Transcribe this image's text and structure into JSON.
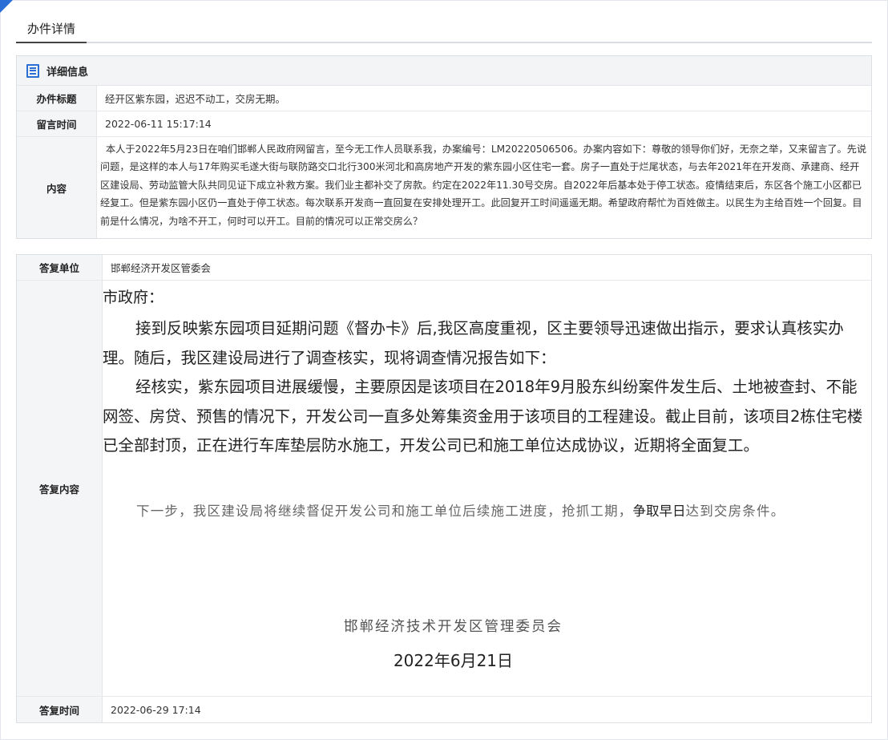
{
  "tab": {
    "label": "办件详情"
  },
  "detail": {
    "heading": "详细信息",
    "title_label": "办件标题",
    "title_value": "经开区紫东园，迟迟不动工，交房无期。",
    "time_label": "留言时间",
    "time_value": "2022-06-11 15:17:14",
    "content_label": "内容",
    "content_value": "本人于2022年5月23日在咱们邯郸人民政府网留言，至今无工作人员联系我，办案编号：LM20220506506。办案内容如下：尊敬的领导你们好，无奈之举，又来留言了。先说问题，是这样的本人与17年购买毛遂大街与联防路交口北行300米河北和高房地产开发的紫东园小区住宅一套。房子一直处于烂尾状态，与去年2021年在开发商、承建商、经开区建设局、劳动监管大队共同见证下成立补救方案。我们业主都补交了房款。约定在2022年11.30号交房。自2022年后基本处于停工状态。疫情结束后，东区各个施工小区都已经复工。但是紫东园小区仍一直处于停工状态。每次联系开发商一直回复在安排处理开工。此回复开工时间遥遥无期。希望政府帮忙为百姓做主。以民生为主给百姓一个回复。目前是什么情况，为啥不开工，何时可以开工。目前的情况可以正常交房么？"
  },
  "reply": {
    "unit_label": "答复单位",
    "unit_value": "邯郸经济开发区管委会",
    "content_label": "答复内容",
    "salutation": "市政府：",
    "para1": "接到反映紫东园项目延期问题《督办卡》后,我区高度重视，区主要领导迅速做出指示，要求认真核实办理。随后，我区建设局进行了调查核实，现将调查情况报告如下：",
    "para2": "经核实，紫东园项目进展缓慢，主要原因是该项目在2018年9月股东纠纷案件发生后、土地被查封、不能网签、房贷、预售的情况下，开发公司一直多处筹集资金用于该项目的工程建设。截止目前，该项目2栋住宅楼已全部封顶，正在进行车库垫层防水施工，开发公司已和施工单位达成协议，近期将全面复工。",
    "para3_a": "下一步，我区建设局将继续督促开发公司和施工单位后续施工进度，抢抓工期，",
    "para3_b": "争取早日",
    "para3_c": "达到交房条件。",
    "signature": "邯郸经济技术开发区管理委员会",
    "sign_date": "2022年6月21日",
    "time_label": "答复时间",
    "time_value": "2022-06-29 17:14"
  },
  "colors": {
    "accent": "#2b6fd6",
    "label_bg": "#f4f5f7",
    "border": "#dcdfe4"
  }
}
